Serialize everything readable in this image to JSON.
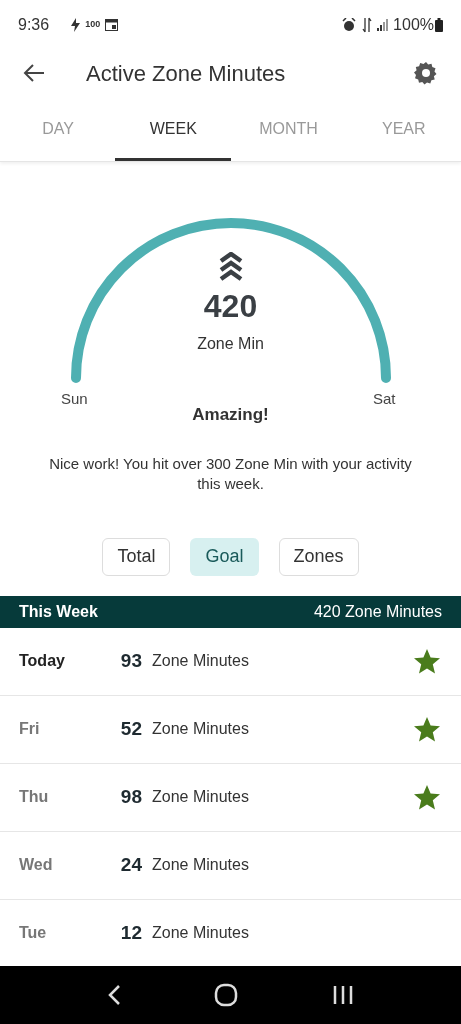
{
  "status_bar": {
    "time": "9:36",
    "notification_count": "100",
    "battery": "100%"
  },
  "header": {
    "title": "Active Zone Minutes"
  },
  "tabs": [
    {
      "label": "DAY",
      "selected": false
    },
    {
      "label": "WEEK",
      "selected": true
    },
    {
      "label": "MONTH",
      "selected": false
    },
    {
      "label": "YEAR",
      "selected": false
    }
  ],
  "gauge": {
    "value": "420",
    "unit": "Zone Min",
    "start_label": "Sun",
    "end_label": "Sat"
  },
  "message": {
    "title": "Amazing!",
    "body": "Nice work! You hit over 300 Zone Min with your activity this week."
  },
  "view_buttons": [
    {
      "label": "Total",
      "selected": false
    },
    {
      "label": "Goal",
      "selected": true
    },
    {
      "label": "Zones",
      "selected": false
    }
  ],
  "week_header": {
    "label": "This Week",
    "total": "420 Zone Minutes"
  },
  "days": [
    {
      "day": "Today",
      "current": true,
      "value": "93",
      "unit": "Zone Minutes",
      "goal_met": true
    },
    {
      "day": "Fri",
      "current": false,
      "value": "52",
      "unit": "Zone Minutes",
      "goal_met": true
    },
    {
      "day": "Thu",
      "current": false,
      "value": "98",
      "unit": "Zone Minutes",
      "goal_met": true
    },
    {
      "day": "Wed",
      "current": false,
      "value": "24",
      "unit": "Zone Minutes",
      "goal_met": false
    },
    {
      "day": "Tue",
      "current": false,
      "value": "12",
      "unit": "Zone Minutes",
      "goal_met": false
    }
  ]
}
